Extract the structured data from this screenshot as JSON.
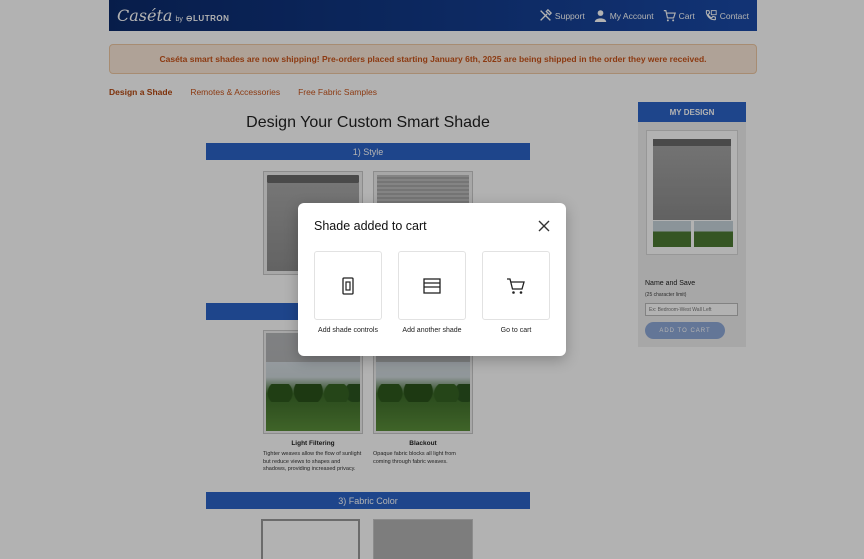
{
  "header": {
    "logo_script": "Caséta",
    "logo_by": "by",
    "logo_brand": "⊖LUTRON",
    "links": [
      {
        "label": "Support",
        "icon": "tools-icon"
      },
      {
        "label": "My Account",
        "icon": "user-icon"
      },
      {
        "label": "Cart",
        "icon": "cart-icon"
      },
      {
        "label": "Contact",
        "icon": "phone-icon"
      }
    ]
  },
  "banner": {
    "text": "Caséta smart shades are now shipping! Pre-orders placed starting January 6th, 2025 are being shipped in the order they were received."
  },
  "tabs": [
    "Design a Shade",
    "Remotes & Accessories",
    "Free Fabric Samples"
  ],
  "main": {
    "title": "Design Your Custom Smart Shade",
    "sections": [
      "1) Style",
      "3) Fabric Color"
    ],
    "opacity_options": [
      {
        "name": "Light Filtering",
        "desc": "Tighter weaves allow the flow of sunlight but reduce views to shapes and shadows, providing increased privacy."
      },
      {
        "name": "Blackout",
        "desc": "Opaque fabric blocks all light from coming through fabric weaves."
      }
    ]
  },
  "sidebar": {
    "header": "MY DESIGN",
    "name_label": "Name and Save",
    "name_hint": "(25 character limit)",
    "name_placeholder": "Ex: Bedroom-West Wall Left",
    "save_button": "ADD TO CART"
  },
  "modal": {
    "title": "Shade added to cart",
    "options": [
      {
        "label": "Add shade controls",
        "icon": "remote-control-icon"
      },
      {
        "label": "Add another shade",
        "icon": "window-shade-icon"
      },
      {
        "label": "Go to cart",
        "icon": "cart-icon"
      }
    ]
  },
  "colors": {
    "brand_blue": "#2b63c8",
    "header_dark": "#0b2a6b",
    "accent_orange": "#c9541b"
  }
}
